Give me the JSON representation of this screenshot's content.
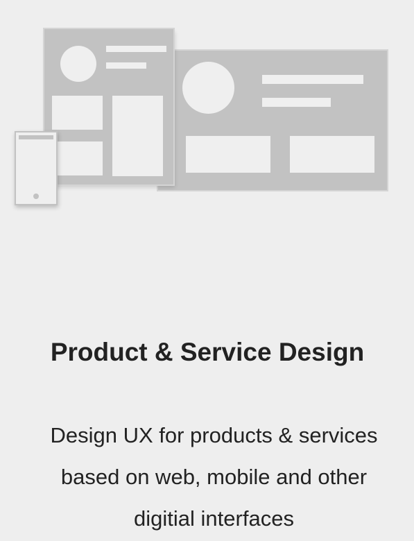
{
  "section": {
    "illustration_icon": "responsive-devices-illustration",
    "title": "Product & Service Design",
    "description_lines": [
      "Design UX for products & services",
      "based on web, mobile and other",
      "digitial interfaces"
    ]
  },
  "colors": {
    "background": "#eeeeee",
    "frame_gray": "#c2c2c2",
    "placeholder_light": "#efefef",
    "text": "#222222"
  }
}
